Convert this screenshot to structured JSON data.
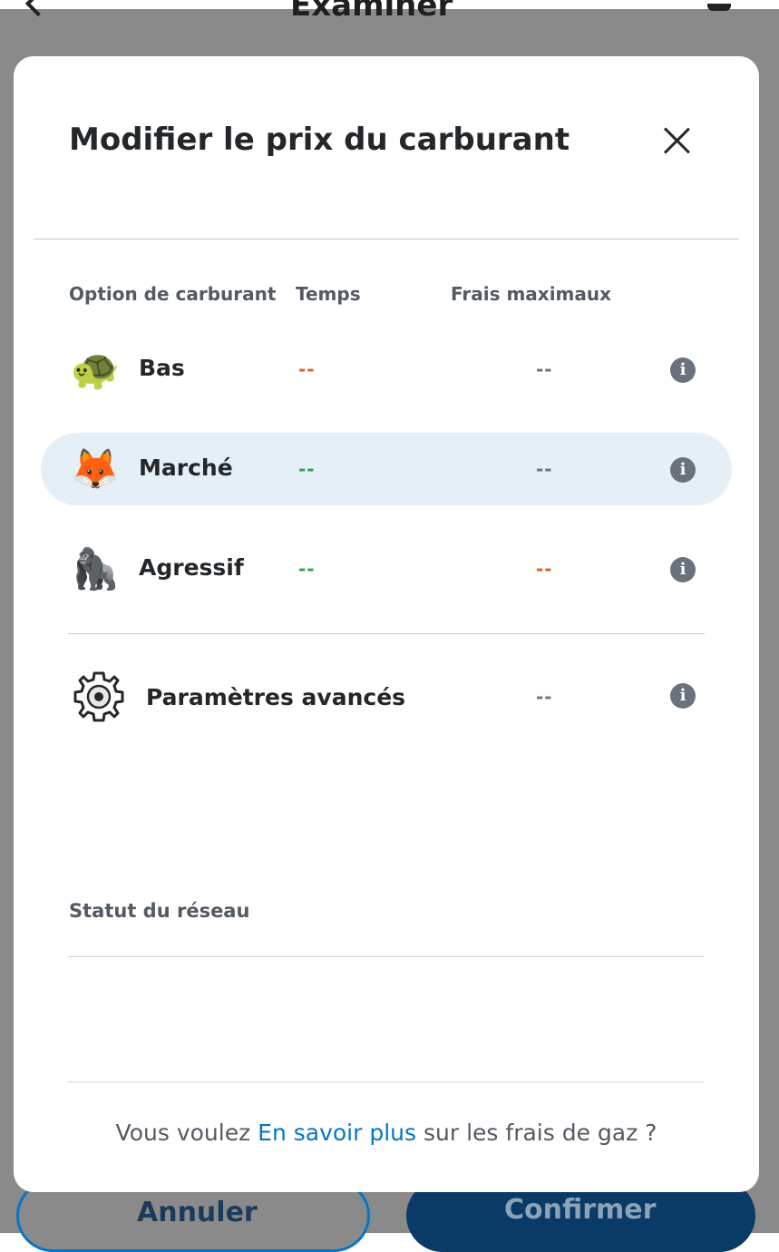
{
  "background": {
    "page_title": "Examiner",
    "cancel_label": "Annuler",
    "confirm_label": "Confirmer"
  },
  "modal": {
    "title": "Modifier le prix du carburant",
    "columns": {
      "option": "Option de carburant",
      "time": "Temps",
      "max_fee": "Frais maximaux"
    },
    "options": [
      {
        "label": "Bas",
        "emoji": "🐢",
        "icon": "turtle-icon",
        "time": "--",
        "max_fee": "--",
        "time_color": "#d9631e",
        "fee_color": "#6a737d",
        "selected": false
      },
      {
        "label": "Marché",
        "emoji": "🦊",
        "icon": "fox-icon",
        "time": "--",
        "max_fee": "--",
        "time_color": "#28a745",
        "fee_color": "#6a737d",
        "selected": true
      },
      {
        "label": "Agressif",
        "emoji": "🦍",
        "icon": "gorilla-icon",
        "time": "--",
        "max_fee": "--",
        "time_color": "#28a745",
        "fee_color": "#d9631e",
        "selected": false
      }
    ],
    "advanced": {
      "label": "Paramètres avancés",
      "icon": "gear-icon",
      "max_fee": "--"
    },
    "network_status_label": "Statut du réseau",
    "footer": {
      "prefix": "Vous voulez ",
      "link": "En savoir plus",
      "suffix": " sur les frais de gaz ?"
    },
    "colors": {
      "accent": "#0376c9",
      "selected_row_bg": "#e5eff7",
      "text": "#24272a",
      "muted": "#535a61"
    }
  }
}
